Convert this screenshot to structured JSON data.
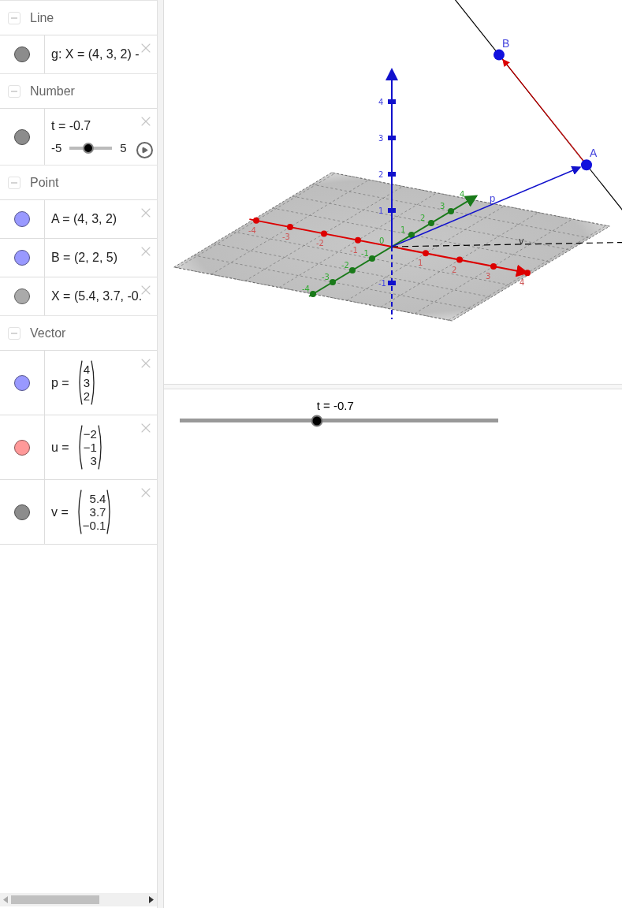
{
  "algebra": {
    "groups": [
      {
        "title": "Line",
        "expanded": true,
        "items": [
          {
            "kind": "text",
            "color": "#8c8c8c",
            "text": "g: X = (4, 3, 2) -"
          }
        ]
      },
      {
        "title": "Number",
        "expanded": true,
        "items": [
          {
            "kind": "slider",
            "color": "#8c8c8c",
            "text": "t = -0.7",
            "min": "-5",
            "max": "5",
            "level": 0.43
          }
        ]
      },
      {
        "title": "Point",
        "expanded": true,
        "items": [
          {
            "kind": "text",
            "color": "#9999ff",
            "text": "A = (4, 3, 2)"
          },
          {
            "kind": "text",
            "color": "#9999ff",
            "text": "B = (2, 2, 5)"
          },
          {
            "kind": "text",
            "color": "#aaaaaa",
            "text": "X = (5.4, 3.7, -0."
          }
        ]
      },
      {
        "title": "Vector",
        "expanded": true,
        "items": [
          {
            "kind": "vector",
            "color": "#9999ff",
            "name": "p =",
            "components": [
              "4",
              "3",
              "2"
            ]
          },
          {
            "kind": "vector",
            "color": "#ff9999",
            "name": "u =",
            "components": [
              "−2",
              "−1",
              "3"
            ]
          },
          {
            "kind": "vector",
            "color": "#8c8c8c",
            "name": "v =",
            "components": [
              "5.4",
              "3.7",
              "−0.1"
            ]
          }
        ]
      }
    ]
  },
  "view3d": {
    "points": [
      {
        "label": "A"
      },
      {
        "label": "B"
      }
    ],
    "vector_labels": [
      "p",
      "v"
    ],
    "origin": "0",
    "x_ticks": [
      "-4",
      "-3",
      "-2",
      "-1",
      "1",
      "2",
      "3",
      "4"
    ],
    "y_ticks": [
      "-4",
      "-3",
      "-2",
      "-1",
      "1",
      "2",
      "3",
      "4"
    ],
    "z_ticks": [
      "4",
      "3",
      "2",
      "1",
      "-1"
    ]
  },
  "graphics": {
    "slider": {
      "label": "t = -0.7",
      "level": 0.43
    }
  }
}
